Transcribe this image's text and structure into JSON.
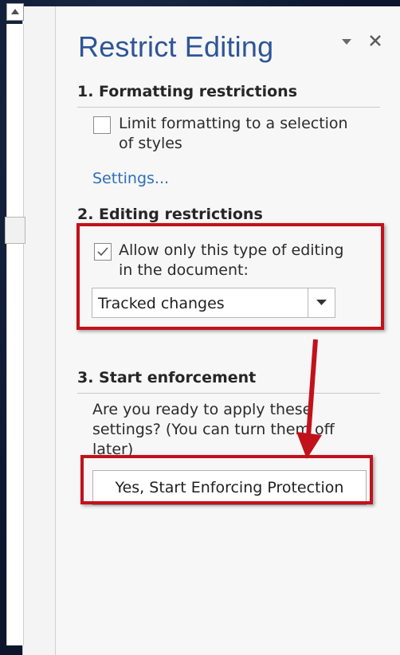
{
  "pane": {
    "title": "Restrict Editing",
    "menu_icon": "dropdown-triangle",
    "close_label": "×"
  },
  "formatting": {
    "heading": "1. Formatting restrictions",
    "checkbox_checked": false,
    "checkbox_label_line1": "Limit formatting to a selection",
    "checkbox_label_line2": "of styles",
    "settings_link": "Settings..."
  },
  "editing": {
    "heading": "2. Editing restrictions",
    "checkbox_checked": true,
    "checkbox_label_line1": "Allow only this type of editing",
    "checkbox_label_line2": "in the document:",
    "dropdown_value": "Tracked changes"
  },
  "enforcement": {
    "heading": "3. Start enforcement",
    "text_line1": "Are you ready to apply these",
    "text_line2": "settings? (You can turn them off",
    "text_line3": "later)",
    "button_label": "Yes, Start Enforcing Protection"
  },
  "annotations": {
    "highlight_color": "#c1121b"
  }
}
